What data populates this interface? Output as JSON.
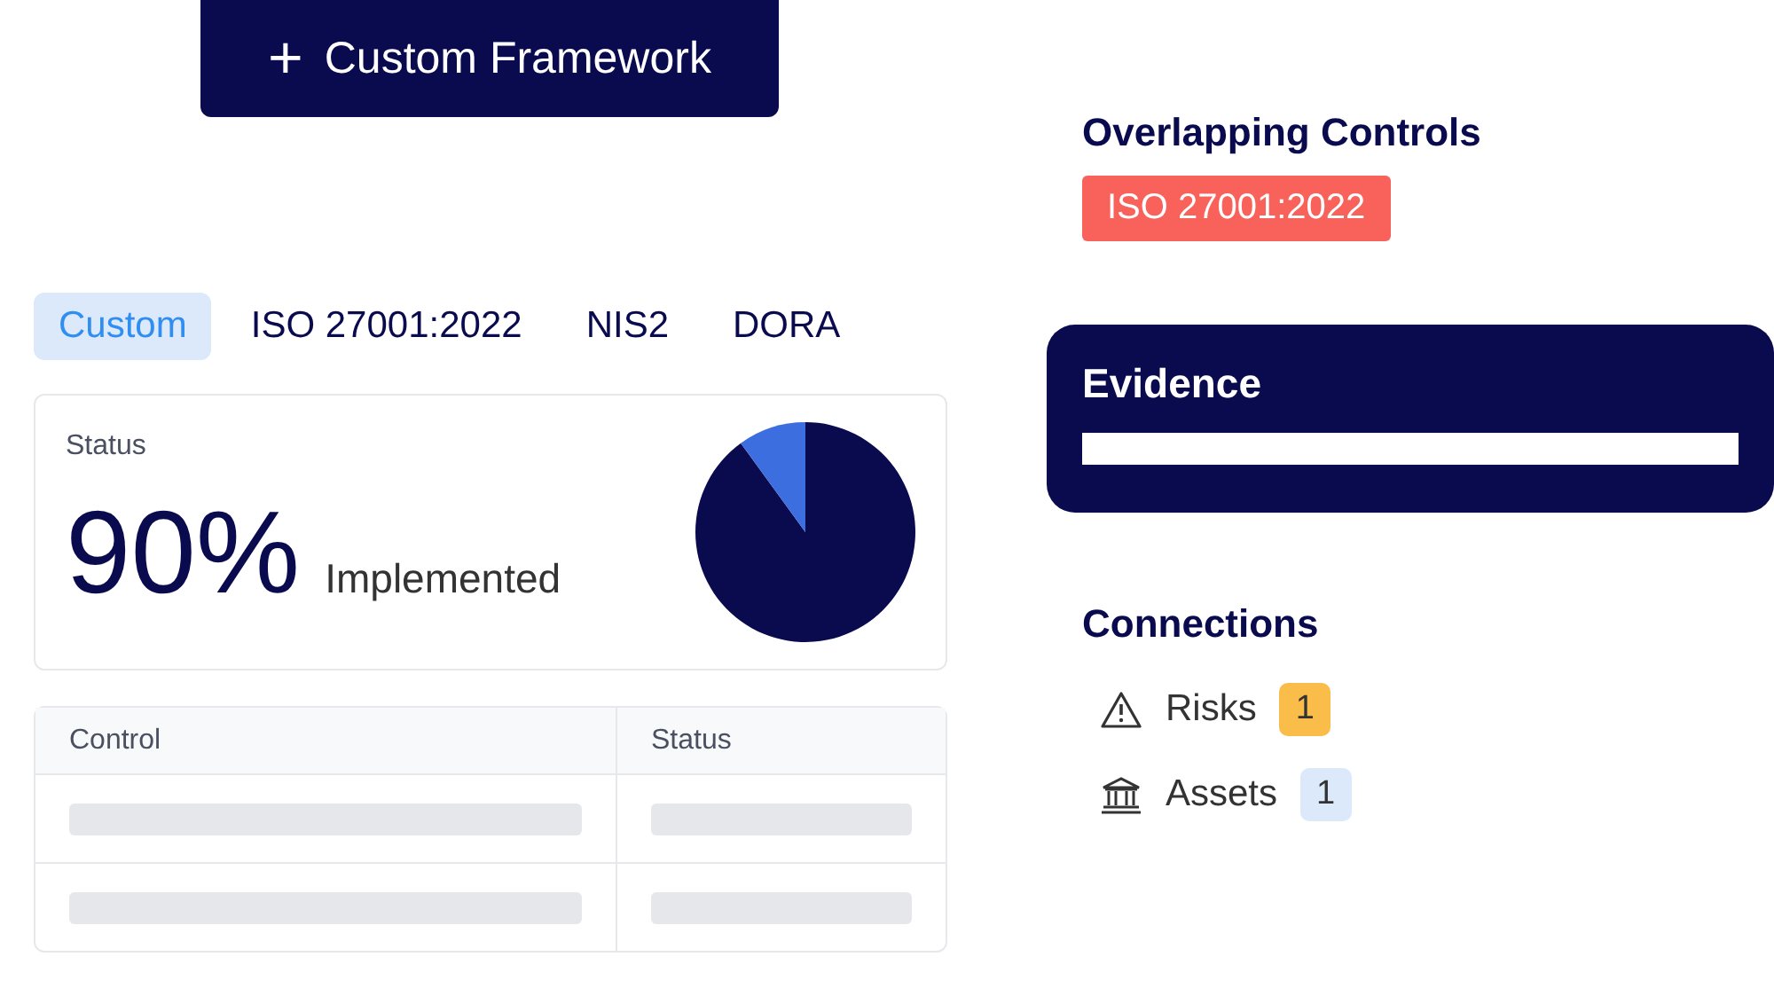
{
  "action_button": {
    "icon": "+",
    "label": "Custom Framework"
  },
  "tabs": [
    {
      "label": "Custom",
      "selected": true
    },
    {
      "label": "ISO 27001:2022",
      "selected": false
    },
    {
      "label": "NIS2",
      "selected": false
    },
    {
      "label": "DORA",
      "selected": false
    }
  ],
  "status_card": {
    "title": "Status",
    "value": "90%",
    "caption": "Implemented",
    "level": 0.9
  },
  "table": {
    "columns": [
      "Control",
      "Status"
    ],
    "rows": [
      {
        "loading": true
      },
      {
        "loading": true
      }
    ]
  },
  "overlapping_controls": {
    "title": "Overlapping Controls",
    "tags": [
      {
        "label": "ISO 27001:2022",
        "color": "#f8625b"
      }
    ]
  },
  "evidence": {
    "title": "Evidence"
  },
  "connections": {
    "title": "Connections",
    "items": [
      {
        "kind": "warning",
        "label": "Risks",
        "count": "1",
        "color": "#fbbd4a"
      },
      {
        "kind": "bank",
        "label": "Assets",
        "count": "1",
        "color": "#dce9fb"
      }
    ]
  }
}
